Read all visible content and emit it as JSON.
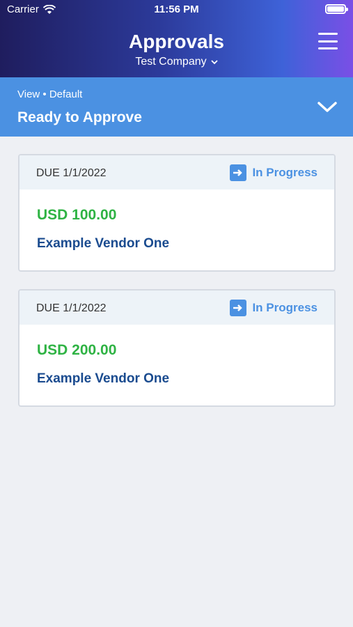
{
  "status_bar": {
    "carrier": "Carrier",
    "time": "11:56 PM"
  },
  "header": {
    "title": "Approvals",
    "company": "Test Company"
  },
  "view": {
    "label": "View • Default",
    "name": "Ready to Approve"
  },
  "cards": [
    {
      "due": "DUE 1/1/2022",
      "status": "In Progress",
      "amount": "USD 100.00",
      "vendor": "Example Vendor One"
    },
    {
      "due": "DUE 1/1/2022",
      "status": "In Progress",
      "amount": "USD 200.00",
      "vendor": "Example Vendor One"
    }
  ],
  "colors": {
    "accent": "#4b91e2",
    "amount": "#2fb344",
    "vendor": "#1a4b8f"
  }
}
